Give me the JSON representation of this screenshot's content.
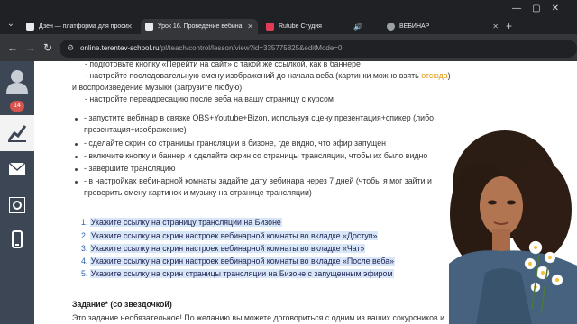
{
  "browser": {
    "tabs": [
      {
        "label": "Дзен — платформа для проси",
        "active": false,
        "icon_color": "#e8eaed"
      },
      {
        "label": "Урок 16. Проведение вебина",
        "active": true,
        "icon_color": "#e8eaed"
      },
      {
        "label": "Rutube Студия",
        "active": false,
        "icon_color": "#e23a57"
      },
      {
        "label": "ВЕБИНАР",
        "active": false,
        "icon_color": "#9aa0a6"
      }
    ],
    "url_host": "online.terentev-school.ru",
    "url_path": "/pl/teach/control/lesson/view?id=335775825&editMode=0"
  },
  "sidebar": {
    "badge": "14",
    "items": [
      "avatar",
      "chart",
      "mail",
      "safe",
      "phone"
    ]
  },
  "lesson": {
    "sub_items": [
      "- подготовьте кнопку «Перейти на сайт» с такой же ссылкой, как в баннере",
      "- настройте последовательную смену изображений до начала веба (картинки можно взять ",
      "и воспроизведение музыки (загрузите любую)",
      "- настройте переадресацию после веба на вашу страницу с курсом"
    ],
    "link_word": "отсюда",
    "link_tail": ")",
    "bullets": [
      "- запустите вебинар в связке OBS+Youtube+Bizon, используя сцену презентация+спикер (либо",
      "презентация+изображение)",
      "- сделайте скрин со страницы трансляции в бизоне, где видно, что эфир запущен",
      "- включите кнопку и баннер и сделайте скрин со страницы трансляции, чтобы их было видно",
      "- завершите трансляцию",
      "- в настройках вебинарной комнаты задайте дату вебинара через 7 дней (чтобы я мог зайти и",
      "проверить смену картинок и музыку на странице трансляции)"
    ],
    "numbered": [
      {
        "n": "1.",
        "text": "Укажите ссылку на страницу трансляции на Бизоне"
      },
      {
        "n": "2.",
        "text": "Укажите ссылку на скрин настроек вебинарной комнаты во вкладке «Доступ»"
      },
      {
        "n": "3.",
        "text": "Укажите ссылку на скрин настроек вебинарной комнаты во вкладке «Чат»"
      },
      {
        "n": "4.",
        "text": "Укажите ссылку на скрин настроек вебинарной комнаты во вкладке «После веба»"
      },
      {
        "n": "5.",
        "text": "Укажите ссылку на скрин страницы трансляции на Бизоне с запущенным эфиром"
      }
    ],
    "task_title": "Задание* (со звездочкой)",
    "task_text": "Это задание необязательное! По желанию вы можете договориться с одним из ваших сокурсников и"
  }
}
